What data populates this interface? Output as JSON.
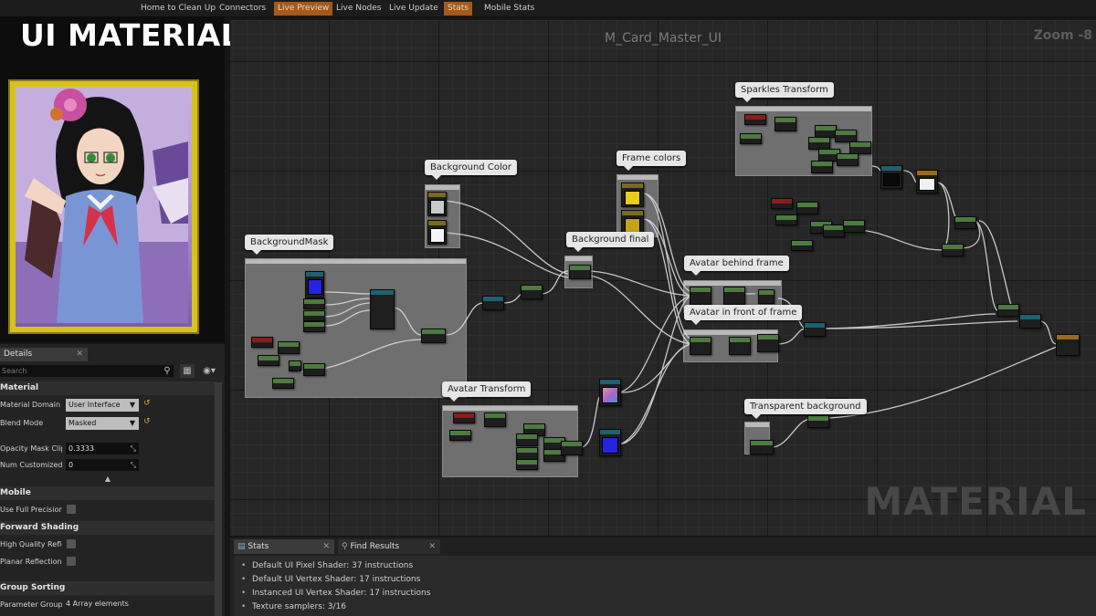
{
  "toolbar": {
    "buttons": [
      "Home to Clean Up",
      "Connectors",
      "Live Preview",
      "Live Nodes",
      "Live Update",
      "Stats",
      "Mobile Stats"
    ]
  },
  "overlay_title": "UI MATERIAL FOR CARDS",
  "details": {
    "tab_label": "Details",
    "search_placeholder": "Search",
    "sections": {
      "material": "Material",
      "mobile": "Mobile",
      "forward_shading": "Forward Shading",
      "group_sorting": "Group Sorting"
    },
    "properties": {
      "material_domain_label": "Material Domain",
      "material_domain_value": "User Interface",
      "blend_mode_label": "Blend Mode",
      "blend_mode_value": "Masked",
      "opacity_mask_clip_label": "Opacity Mask Clip Value",
      "opacity_mask_clip_value": "0.3333",
      "num_customized_uvs_label": "Num Customized UVs",
      "num_customized_uvs_value": "0",
      "use_full_precision_label": "Use Full Precision",
      "high_quality_reflections_label": "High Quality Reflections",
      "planar_reflections_label": "Planar Reflections",
      "parameter_group_data_label": "Parameter Group Data",
      "parameter_group_data_value": "4 Array elements"
    }
  },
  "graph": {
    "title": "M_Card_Master_UI",
    "zoom": "Zoom -8",
    "watermark": "MATERIAL",
    "comments": {
      "background_mask": "BackgroundMask",
      "background_color": "Background Color",
      "frame_colors": "Frame colors",
      "background_final": "Background final",
      "sparkles_transform": "Sparkles Transform",
      "avatar_behind_frame": "Avatar behind frame",
      "avatar_in_front_of_frame": "Avatar in front of frame",
      "avatar_transform": "Avatar Transform",
      "transparent_background": "Transparent background"
    }
  },
  "stats": {
    "tabs": [
      "Stats",
      "Find Results"
    ],
    "lines": [
      "Default UI Pixel Shader: 37 instructions",
      "Default UI Vertex Shader: 17 instructions",
      "Instanced UI Vertex Shader: 17 instructions",
      "Texture samplers: 3/16"
    ]
  },
  "colors": {
    "accent_orange": "#a35a1c",
    "frame_yellow": "#d7c21c",
    "card_purple": "#b79bcf"
  }
}
